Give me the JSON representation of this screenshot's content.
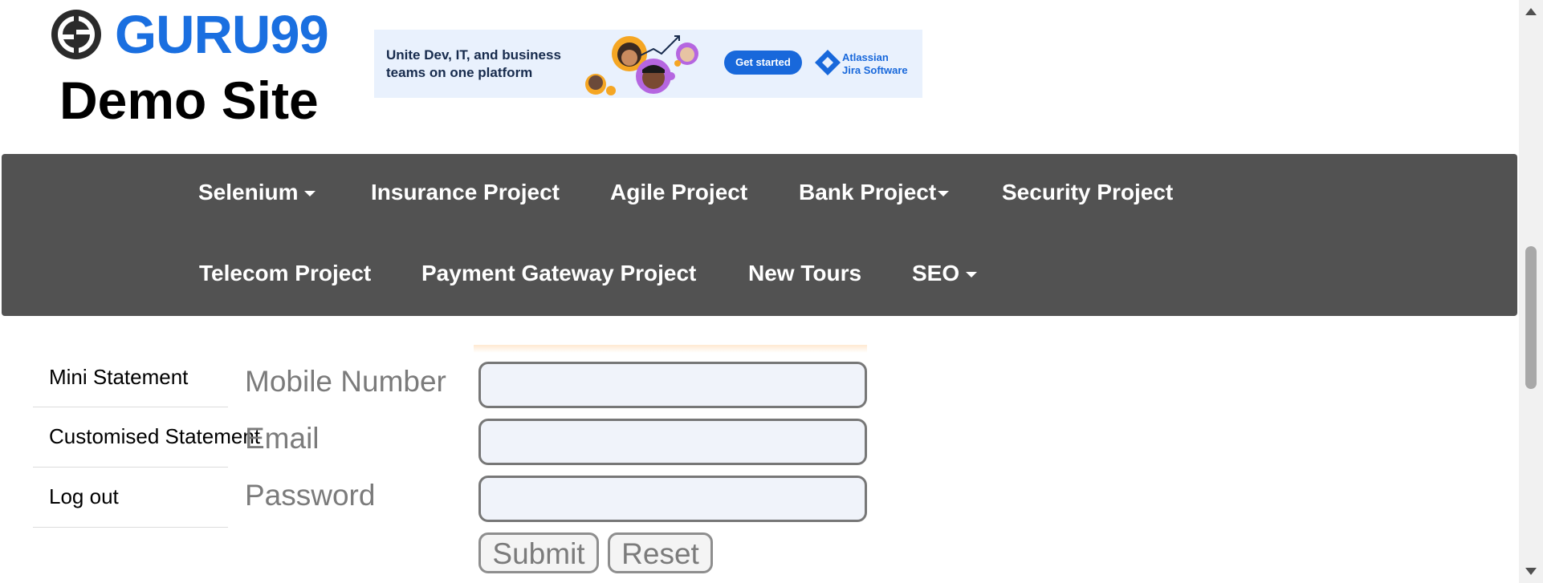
{
  "logo": {
    "brand": "GURU99",
    "subtitle": "Demo Site"
  },
  "ad": {
    "headline": "Unite Dev, IT, and business teams on one platform",
    "cta": "Get started",
    "brand_line1": "Atlassian",
    "brand_line2": "Jira Software"
  },
  "nav": {
    "row1": [
      {
        "label": "Selenium",
        "dropdown": true
      },
      {
        "label": "Insurance Project",
        "dropdown": false
      },
      {
        "label": "Agile Project",
        "dropdown": false
      },
      {
        "label": "Bank Project",
        "dropdown": true
      },
      {
        "label": "Security Project",
        "dropdown": false
      }
    ],
    "row2": [
      {
        "label": "Telecom Project",
        "dropdown": false
      },
      {
        "label": "Payment Gateway Project",
        "dropdown": false
      },
      {
        "label": "New Tours",
        "dropdown": false
      },
      {
        "label": "SEO",
        "dropdown": true
      }
    ]
  },
  "sidebar": {
    "items": [
      {
        "label": "Mini Statement"
      },
      {
        "label": "Customised Statement"
      },
      {
        "label": "Log out"
      }
    ]
  },
  "form": {
    "mobile_label": "Mobile Number",
    "mobile_value": "",
    "email_label": "Email",
    "email_value": "",
    "password_label": "Password",
    "password_value": "",
    "submit_label": "Submit",
    "reset_label": "Reset"
  },
  "colors": {
    "brand_blue": "#1a6fe0",
    "nav_background": "#525252",
    "ad_background": "#e9f1fd",
    "cta_blue": "#1868db"
  }
}
